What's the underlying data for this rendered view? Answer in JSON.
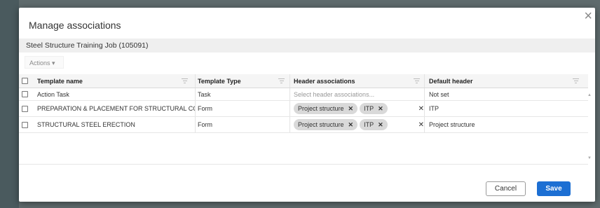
{
  "dialog": {
    "title": "Manage associations",
    "close_glyph": "×",
    "job_name": "Steel Structure Training Job (105091)",
    "actions_label": "Actions ▾",
    "scroll_up_glyph": "▲",
    "scroll_down_glyph": "▼"
  },
  "grid": {
    "columns": {
      "name": "Template name",
      "type": "Template Type",
      "header": "Header associations",
      "default": "Default header"
    },
    "rows": [
      {
        "name": "Action Task",
        "type": "Task",
        "header_placeholder": "Select header associations...",
        "chips": [],
        "default": "Not set"
      },
      {
        "name": "PREPARATION & PLACEMENT FOR STRUCTURAL CONCR...",
        "type": "Form",
        "chips": [
          "Project structure",
          "ITP"
        ],
        "default": "ITP"
      },
      {
        "name": "STRUCTURAL STEEL ERECTION",
        "type": "Form",
        "chips": [
          "Project structure",
          "ITP"
        ],
        "default": "Project structure"
      }
    ],
    "chip_remove_glyph": "✕",
    "clear_glyph": "✕"
  },
  "footer": {
    "cancel_label": "Cancel",
    "save_label": "Save"
  },
  "colors": {
    "primary": "#1c6fd3",
    "overlay": "#5f6b6d"
  }
}
